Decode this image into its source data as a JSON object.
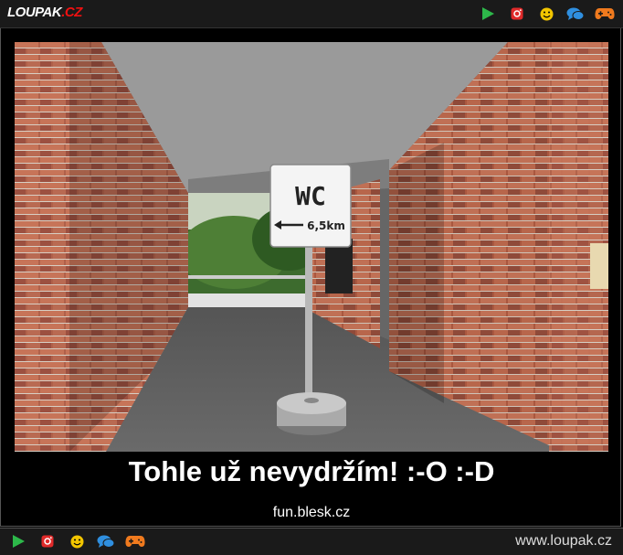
{
  "header": {
    "logo_main": "LOUPAK",
    "logo_suffix": ".CZ",
    "icons": [
      "play-icon",
      "instagram-icon",
      "smiley-icon",
      "chat-icon",
      "gamepad-icon"
    ]
  },
  "post": {
    "sign_title": "WC",
    "sign_distance": "6,5km",
    "caption": "Tohle už nevydržím! :-O :-D",
    "source": "fun.blesk.cz"
  },
  "footer": {
    "site": "www.loupak.cz",
    "icons": [
      "play-icon",
      "instagram-icon",
      "smiley-icon",
      "chat-icon",
      "gamepad-icon"
    ]
  },
  "colors": {
    "play": "#2db84a",
    "instagram": "#e02a2a",
    "smiley": "#f2c500",
    "chat": "#2f8fe0",
    "gamepad": "#f07a1e"
  }
}
